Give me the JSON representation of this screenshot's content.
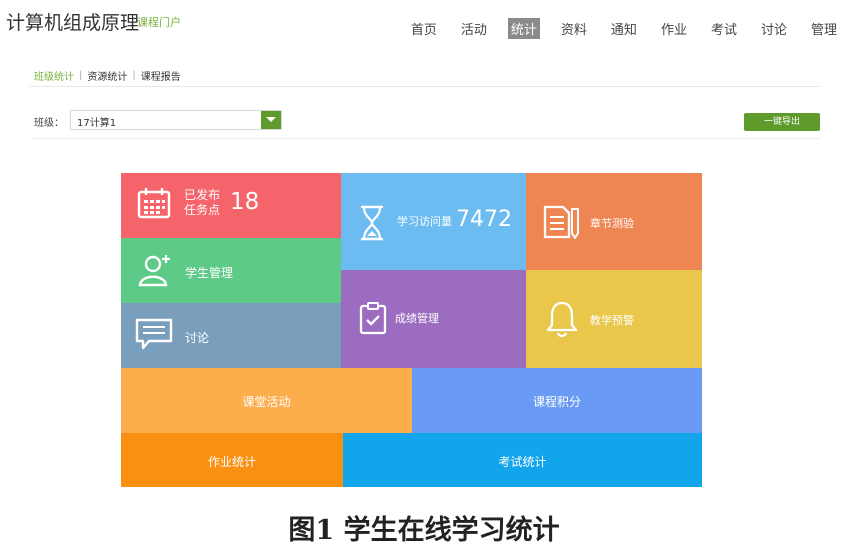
{
  "header": {
    "title": "计算机组成原理",
    "subtitle": "课程门户",
    "nav": [
      {
        "label": "首页"
      },
      {
        "label": "活动"
      },
      {
        "label": "统计"
      },
      {
        "label": "资料"
      },
      {
        "label": "通知"
      },
      {
        "label": "作业"
      },
      {
        "label": "考试"
      },
      {
        "label": "讨论"
      },
      {
        "label": "管理"
      }
    ],
    "active_nav": "统计"
  },
  "subtabs": [
    {
      "label": "班级统计"
    },
    {
      "label": "资源统计"
    },
    {
      "label": "课程报告"
    }
  ],
  "filter": {
    "label": "班级：",
    "selected": "17计算1",
    "export_label": "一键导出"
  },
  "tiles": {
    "publish": {
      "line1": "已发布",
      "line2": "任务点",
      "value": "18",
      "icon": "calendar-icon"
    },
    "students": {
      "label": "学生管理",
      "icon": "user-add-icon"
    },
    "discuss": {
      "label": "讨论",
      "icon": "chat-icon"
    },
    "visits": {
      "label": "学习访问量",
      "value": "7472",
      "icon": "hourglass-icon"
    },
    "grades": {
      "label": "成绩管理",
      "icon": "clipboard-check-icon"
    },
    "chapter": {
      "label": "章节测验",
      "icon": "document-icon"
    },
    "warning": {
      "label": "教学预警",
      "icon": "bell-icon"
    },
    "class_activity": {
      "label": "课堂活动"
    },
    "points": {
      "label": "课程积分"
    },
    "homework": {
      "label": "作业统计"
    },
    "exam": {
      "label": "考试统计"
    }
  },
  "colors": {
    "accent_green": "#5e9b2c",
    "publish": "#f4646a",
    "students": "#5dcb87",
    "discuss": "#7a9fbc",
    "visits": "#6cbcf1",
    "grades": "#9b6cc0",
    "chapter": "#ef8553",
    "warning": "#e9c74a",
    "class_activity": "#fbae4b",
    "points": "#6a9bf4",
    "homework": "#fa9011",
    "exam": "#12a5eb"
  },
  "caption": "图1  学生在线学习统计"
}
